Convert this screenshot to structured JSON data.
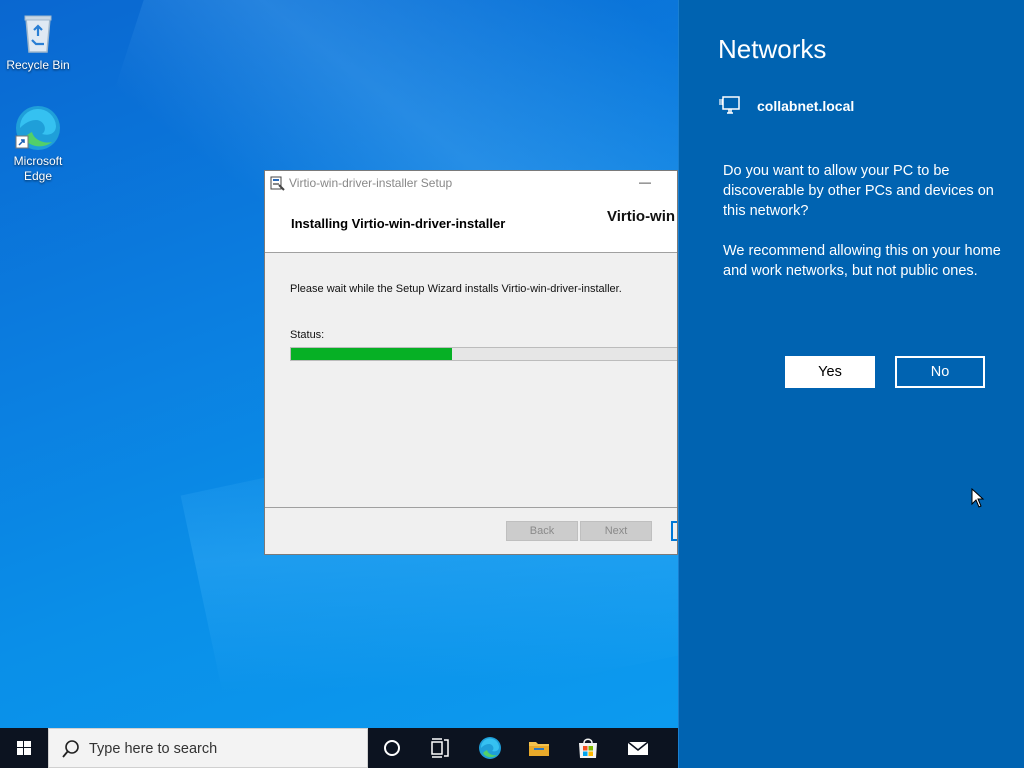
{
  "desktop": {
    "icons": [
      {
        "label": "Recycle Bin"
      },
      {
        "label": "Microsoft Edge"
      }
    ]
  },
  "setup_window": {
    "title": "Virtio-win-driver-installer Setup",
    "minimize_glyph": "—",
    "heading": "Installing Virtio-win-driver-installer",
    "brand": "Virtio-win",
    "description": "Please wait while the Setup Wizard installs Virtio-win-driver-installer.",
    "status_label": "Status:",
    "progress_fraction": 0.41,
    "back_label": "Back",
    "next_label": "Next"
  },
  "networks_flyout": {
    "heading": "Networks",
    "network_name": "collabnet.local",
    "question": "Do you want to allow your PC to be discoverable by other PCs and devices on this network?",
    "recommendation": "We recommend allowing this on your home and work networks, but not public ones.",
    "yes_label": "Yes",
    "no_label": "No",
    "colors": {
      "background": "#0063b1"
    }
  },
  "taskbar": {
    "search_placeholder": "Type here to search",
    "icons": [
      "windows-start-icon",
      "search-icon",
      "cortana-icon",
      "task-view-icon",
      "edge-icon",
      "file-explorer-icon",
      "store-icon",
      "mail-icon"
    ]
  },
  "colors": {
    "progress_fill": "#06b025",
    "taskbar": "#0c1320"
  }
}
